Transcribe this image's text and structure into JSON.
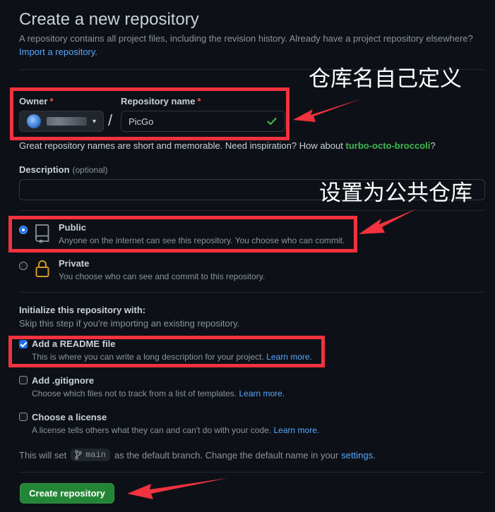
{
  "header": {
    "title": "Create a new repository",
    "intro_text": "A repository contains all project files, including the revision history. Already have a project repository elsewhere?",
    "import_link": "Import a repository."
  },
  "owner": {
    "label": "Owner",
    "required_mark": "*",
    "caret": "▾"
  },
  "separator": "/",
  "repository_name": {
    "label": "Repository name",
    "required_mark": "*",
    "value": "PicGo"
  },
  "name_hint": {
    "text": "Great repository names are short and memorable. Need inspiration? How about",
    "suggestion": "turbo-octo-broccoli",
    "suffix": "?"
  },
  "description": {
    "label": "Description",
    "optional_label": "(optional)",
    "value": ""
  },
  "visibility": {
    "public": {
      "title": "Public",
      "description": "Anyone on the internet can see this repository. You choose who can commit."
    },
    "private": {
      "title": "Private",
      "description": "You choose who can see and commit to this repository."
    }
  },
  "initialize": {
    "title": "Initialize this repository with:",
    "subtitle": "Skip this step if you're importing an existing repository.",
    "readme": {
      "title": "Add a README file",
      "description": "This is where you can write a long description for your project.",
      "link": "Learn more."
    },
    "gitignore": {
      "title": "Add .gitignore",
      "description": "Choose which files not to track from a list of templates.",
      "link": "Learn more."
    },
    "license": {
      "title": "Choose a license",
      "description": "A license tells others what they can and can't do with your code.",
      "link": "Learn more."
    }
  },
  "branch": {
    "prefix": "This will set",
    "branch_name": "main",
    "middle": "as the default branch. Change the default name in your",
    "settings_link": "settings."
  },
  "create_button": "Create repository",
  "annotations": {
    "repo_name_callout": "仓库名自己定义",
    "public_callout": "设置为公共仓库"
  },
  "colors": {
    "background": "#0d1117",
    "link": "#58a6ff",
    "accent_green": "#238636",
    "annotation_red": "#f2323e"
  }
}
